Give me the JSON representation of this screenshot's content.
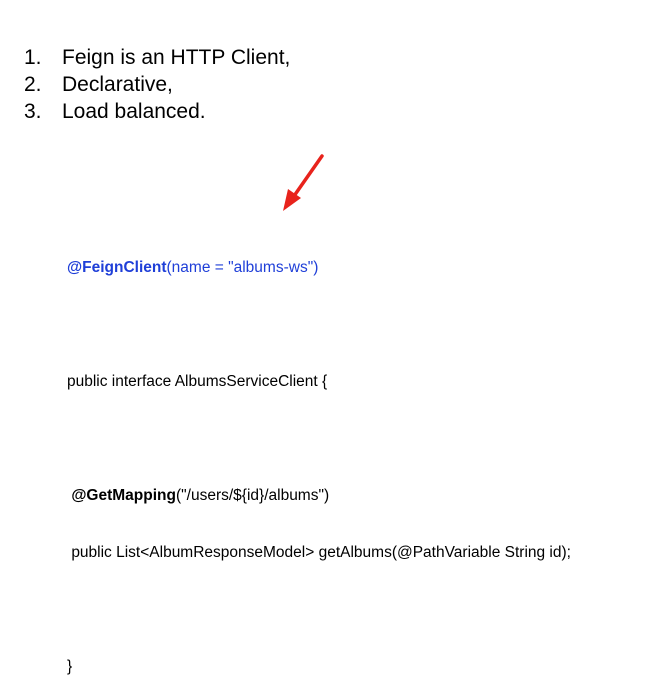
{
  "list": {
    "items": [
      {
        "number": "1.",
        "text": "Feign is an HTTP Client,"
      },
      {
        "number": "2.",
        "text": "Declarative,"
      },
      {
        "number": "3.",
        "text": "Load balanced."
      }
    ]
  },
  "code": {
    "annotation": "@FeignClient",
    "annotation_args": "(name = \"albums-ws\")",
    "interface_decl": "public interface AlbumsServiceClient {",
    "method_annotation": "@GetMapping",
    "method_annotation_args": "(\"/users/${id}/albums\")",
    "method_signature": "public List<AlbumResponseModel> getAlbums(@PathVariable String id);",
    "closing_brace": "}"
  },
  "colors": {
    "annotation_blue": "#1f3fd8",
    "arrow_red": "#e8231c"
  },
  "icons": {
    "arrow": "red-arrow-icon"
  }
}
